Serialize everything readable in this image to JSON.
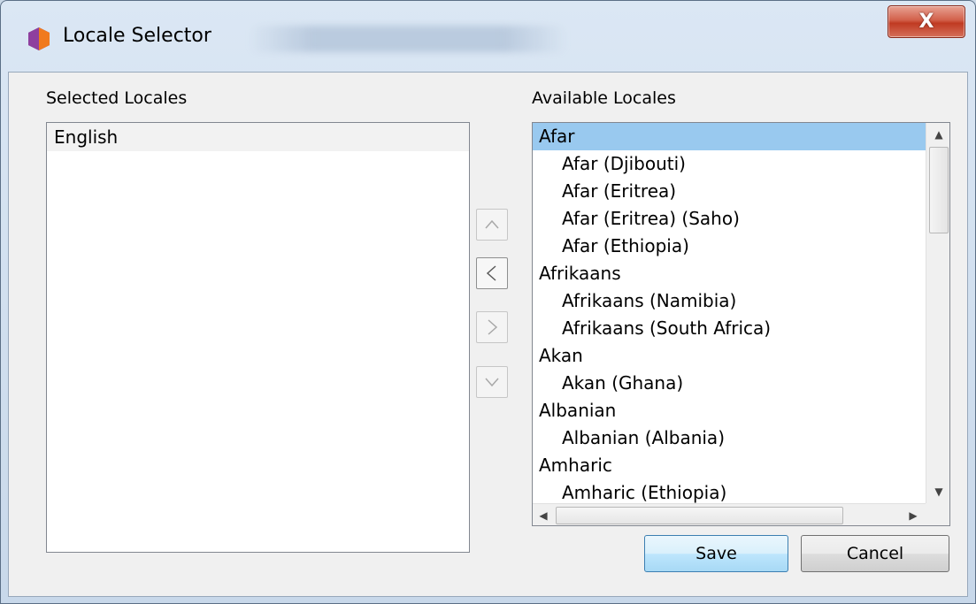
{
  "window": {
    "title": "Locale Selector",
    "close_label": "X"
  },
  "selected": {
    "label": "Selected Locales",
    "items": [
      "English"
    ]
  },
  "available": {
    "label": "Available Locales",
    "items": [
      {
        "label": "Afar",
        "level": 0,
        "selected": true
      },
      {
        "label": "Afar (Djibouti)",
        "level": 1
      },
      {
        "label": "Afar (Eritrea)",
        "level": 1
      },
      {
        "label": "Afar (Eritrea) (Saho)",
        "level": 1
      },
      {
        "label": "Afar (Ethiopia)",
        "level": 1
      },
      {
        "label": "Afrikaans",
        "level": 0
      },
      {
        "label": "Afrikaans (Namibia)",
        "level": 1
      },
      {
        "label": "Afrikaans (South Africa)",
        "level": 1
      },
      {
        "label": "Akan",
        "level": 0
      },
      {
        "label": "Akan (Ghana)",
        "level": 1
      },
      {
        "label": "Albanian",
        "level": 0
      },
      {
        "label": "Albanian (Albania)",
        "level": 1
      },
      {
        "label": "Amharic",
        "level": 0
      },
      {
        "label": "Amharic (Ethiopia)",
        "level": 1
      }
    ]
  },
  "buttons": {
    "save": "Save",
    "cancel": "Cancel"
  },
  "icons": {
    "move_up": "chevron-up-icon",
    "add": "chevron-left-icon",
    "remove": "chevron-right-icon",
    "move_down": "chevron-down-icon"
  },
  "colors": {
    "selection": "#99c9ef",
    "close_button": "#c7432b"
  }
}
